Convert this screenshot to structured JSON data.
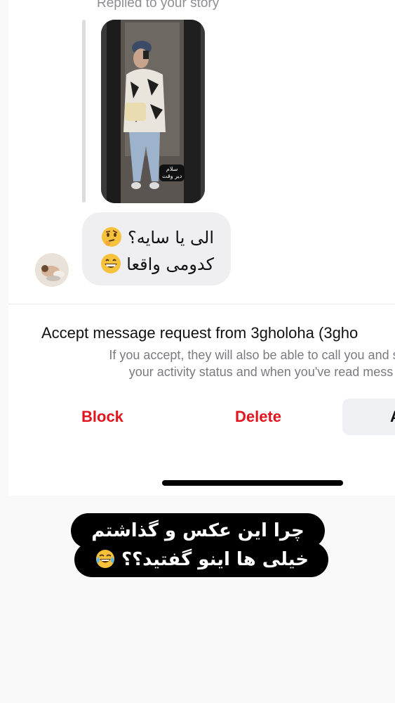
{
  "story_reply": {
    "label": "Replied to your story",
    "sticker_line1": "سلام",
    "sticker_line2": "دیر وقت"
  },
  "message": {
    "line1": "الی یا سایه؟",
    "line1_emoji": "thinking-face",
    "line2": "کدومی واقعا",
    "line2_emoji": "grinning-face"
  },
  "request": {
    "title": "Accept message request from 3gholoha (3gho",
    "desc_line1": "If you accept, they will also be able to call you and see",
    "desc_line2": "your activity status and when you've read mess",
    "block_label": "Block",
    "delete_label": "Delete",
    "accept_label": "A"
  },
  "caption": {
    "line1": "چرا این عکس و گذاشتم",
    "line2": "خیلی ها اینو گفتید؟؟",
    "line2_emoji": "face-with-tears-of-joy"
  },
  "colors": {
    "destructive": "#e0151d",
    "bubble": "#efeff1",
    "caption_bg": "#000000"
  }
}
